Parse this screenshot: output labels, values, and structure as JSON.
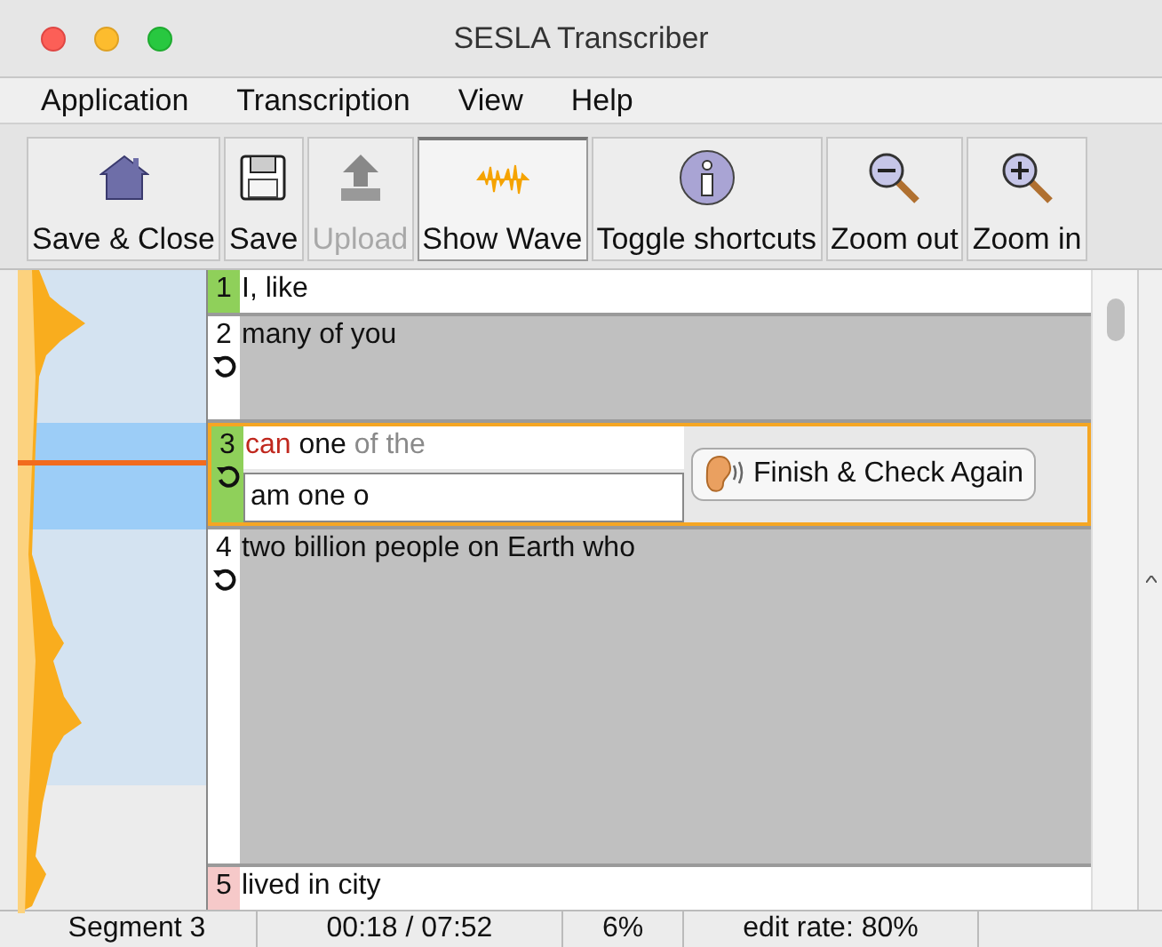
{
  "window": {
    "title": "SESLA Transcriber"
  },
  "menu": [
    "Application",
    "Transcription",
    "View",
    "Help"
  ],
  "toolbar": [
    {
      "kind": "house",
      "label": "Save & Close",
      "disabled": false,
      "selected": false
    },
    {
      "kind": "disk",
      "label": "Save",
      "disabled": false,
      "selected": false
    },
    {
      "kind": "upload",
      "label": "Upload",
      "disabled": true,
      "selected": false
    },
    {
      "kind": "wave",
      "label": "Show Wave",
      "disabled": false,
      "selected": true
    },
    {
      "kind": "info",
      "label": "Toggle shortcuts",
      "disabled": false,
      "selected": false
    },
    {
      "kind": "zoomout",
      "label": "Zoom out",
      "disabled": false,
      "selected": false
    },
    {
      "kind": "zoomin",
      "label": "Zoom in",
      "disabled": false,
      "selected": false
    }
  ],
  "segments": [
    {
      "number": "1",
      "kind": "reviewed",
      "text": "I, like",
      "repeat": false,
      "selected": false
    },
    {
      "number": "2",
      "kind": "pending",
      "text": "many of you",
      "repeat": true,
      "selected": false
    },
    {
      "number": "3",
      "kind": "reviewed",
      "repeat": true,
      "selected": true,
      "words": [
        {
          "text": "can",
          "kind": "wrong"
        },
        {
          "text": "one",
          "kind": "correct"
        },
        {
          "text": "of the",
          "kind": "missing"
        }
      ],
      "input": "am one o",
      "button": "Finish & Check Again"
    },
    {
      "number": "4",
      "kind": "pending",
      "text": "two billion people on Earth who",
      "repeat": true,
      "selected": false
    },
    {
      "number": "5",
      "kind": "flagged",
      "text": "lived in city",
      "repeat": false,
      "selected": false
    }
  ],
  "status_bar": [
    "Segment 3",
    "00:18 / 07:52",
    "6%",
    "edit rate: 80%"
  ]
}
